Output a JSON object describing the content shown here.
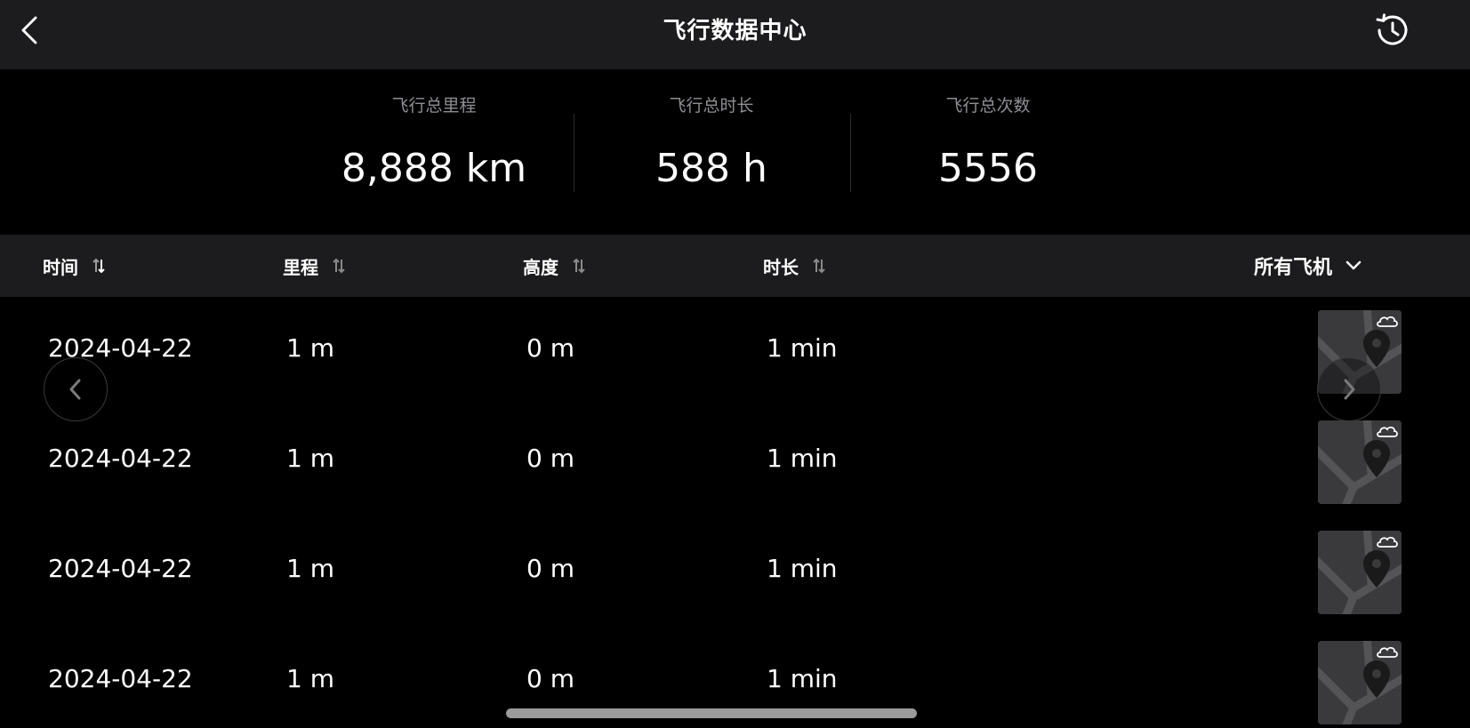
{
  "header": {
    "title": "飞行数据中心",
    "back_icon": "chevron-left-icon",
    "history_icon": "history-icon"
  },
  "summary": {
    "total_distance": {
      "label": "飞行总里程",
      "value": "8,888 km"
    },
    "total_duration": {
      "label": "飞行总时长",
      "value": "588 h"
    },
    "total_count": {
      "label": "飞行总次数",
      "value": "5556"
    }
  },
  "columns": {
    "time": "时间",
    "distance": "里程",
    "altitude": "高度",
    "duration": "时长",
    "sort_icon": "sort-icon"
  },
  "filter": {
    "label": "所有飞机",
    "icon": "chevron-down-icon"
  },
  "rows": [
    {
      "date": "2024-04-22",
      "distance": "1 m",
      "altitude": "0 m",
      "duration": "1 min"
    },
    {
      "date": "2024-04-22",
      "distance": "1 m",
      "altitude": "0 m",
      "duration": "1 min"
    },
    {
      "date": "2024-04-22",
      "distance": "1 m",
      "altitude": "0 m",
      "duration": "1 min"
    },
    {
      "date": "2024-04-22",
      "distance": "1 m",
      "altitude": "0 m",
      "duration": "1 min"
    }
  ],
  "row_thumbnail_icons": [
    "map-thumbnail",
    "map-pin-icon",
    "cloud-icon"
  ],
  "colors": {
    "background": "#000000",
    "header_bg": "#1c1c1e",
    "muted_text": "#8e8e93",
    "text": "#ffffff"
  }
}
